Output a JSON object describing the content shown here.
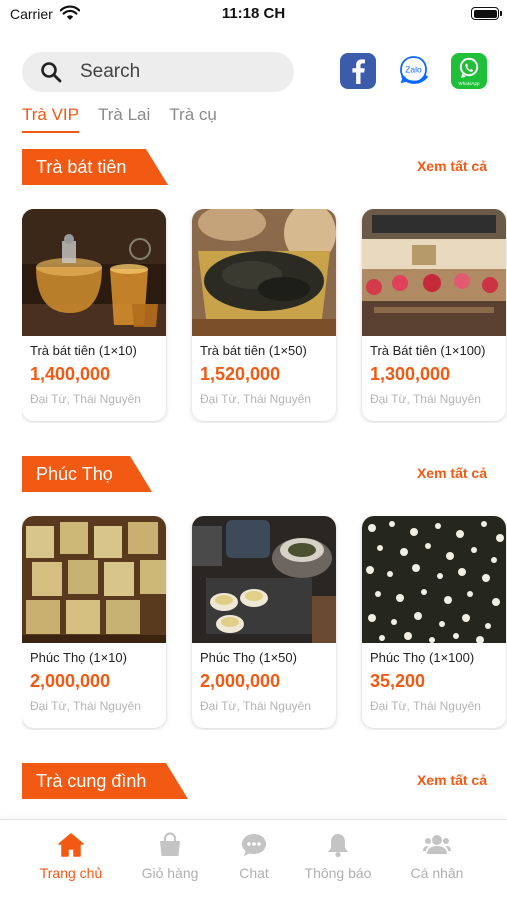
{
  "status_bar": {
    "carrier": "Carrier",
    "time": "11:18 CH"
  },
  "search": {
    "placeholder": "Search"
  },
  "social": [
    {
      "name": "facebook",
      "icon": "facebook-icon",
      "color": "#3b5bab"
    },
    {
      "name": "zalo",
      "icon": "zalo-icon",
      "label": "Zalo",
      "color": "#0a68ff"
    },
    {
      "name": "whatsapp",
      "icon": "whatsapp-icon",
      "label": "WhatsApp",
      "color": "#1fbf3a"
    }
  ],
  "tabs": [
    {
      "label": "Trà VIP",
      "active": true
    },
    {
      "label": "Trà Lai",
      "active": false
    },
    {
      "label": "Trà cụ",
      "active": false
    }
  ],
  "sections": [
    {
      "title": "Trà bát tiên",
      "see_all": "Xem tất cả",
      "products": [
        {
          "name": "Trà bát tiên (1×10)",
          "price": "1,400,000",
          "location": "Đại Từ, Thái Nguyên"
        },
        {
          "name": "Trà bát tiên (1×50)",
          "price": "1,520,000",
          "location": "Đại Từ, Thái Nguyên"
        },
        {
          "name": "Trà Bát tiên (1×100)",
          "price": "1,300,000",
          "location": "Đại Từ, Thái Nguyên"
        }
      ]
    },
    {
      "title": "Phúc Thọ",
      "see_all": "Xem tất cả",
      "products": [
        {
          "name": "Phúc Thọ (1×10)",
          "price": "2,000,000",
          "location": "Đại Từ, Thái Nguyên"
        },
        {
          "name": "Phúc Thọ (1×50)",
          "price": "2,000,000",
          "location": "Đại Từ, Thái Nguyên"
        },
        {
          "name": "Phúc Thọ (1×100)",
          "price": "35,200",
          "location": "Đại Từ, Thái Nguyên"
        }
      ]
    },
    {
      "title": "Trà cung đình",
      "see_all": "Xem tất cả",
      "products": []
    }
  ],
  "bottom_nav": [
    {
      "label": "Trang chủ",
      "icon": "home-icon",
      "active": true
    },
    {
      "label": "Giỏ hàng",
      "icon": "shopping-bag-icon",
      "active": false
    },
    {
      "label": "Chat",
      "icon": "chat-bubble-icon",
      "active": false
    },
    {
      "label": "Thông báo",
      "icon": "bell-icon",
      "active": false
    },
    {
      "label": "Cá nhân",
      "icon": "users-icon",
      "active": false
    }
  ],
  "colors": {
    "accent": "#f25a13",
    "muted": "#b0b0b0",
    "search_bg": "#ededed"
  }
}
